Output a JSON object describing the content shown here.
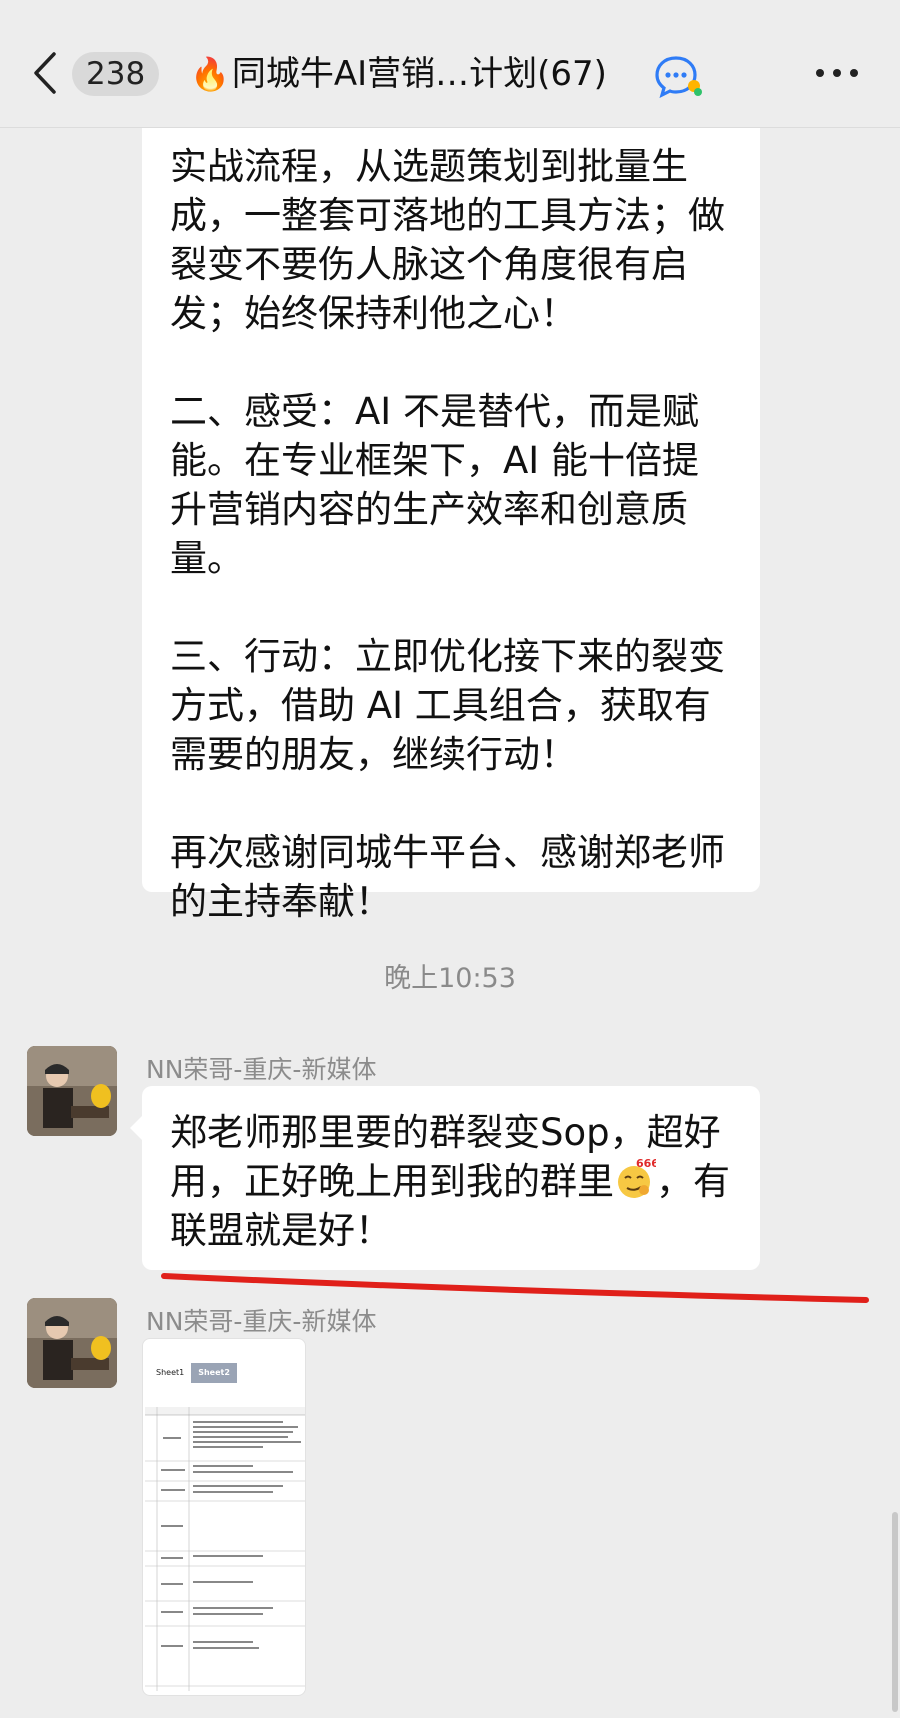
{
  "header": {
    "unread_count": "238",
    "title_emoji": "🔥",
    "title": "同城牛AI营销…计划(67)"
  },
  "messages": {
    "top_bubble": {
      "paragraphs": [
        "实战流程，从选题策划到批量生成，一整套可落地的工具方法；做裂变不要伤人脉这个角度很有启发；始终保持利他之心！",
        "二、感受：AI 不是替代，而是赋能。在专业框架下，AI 能十倍提升营销内容的生产效率和创意质量。",
        "三、行动：立即优化接下来的裂变方式，借助 AI 工具组合，获取有需要的朋友，继续行动！",
        "再次感谢同城牛平台、感谢郑老师的主持奉献！"
      ]
    },
    "timestamp": "晚上10:53",
    "msg2": {
      "sender": "NN荣哥-重庆-新媒体",
      "text_before": "郑老师那里要的群裂变Sop，超好用，正好晚上用到我的群里",
      "emoji_label": "666",
      "text_after": "，有联盟就是好！"
    },
    "msg3": {
      "sender": "NN荣哥-重庆-新媒体",
      "sheet_tab1": "Sheet1",
      "sheet_tab2": "Sheet2"
    }
  },
  "colors": {
    "background": "#ededed",
    "bubble": "#ffffff",
    "annotation_line": "#e0201a"
  }
}
